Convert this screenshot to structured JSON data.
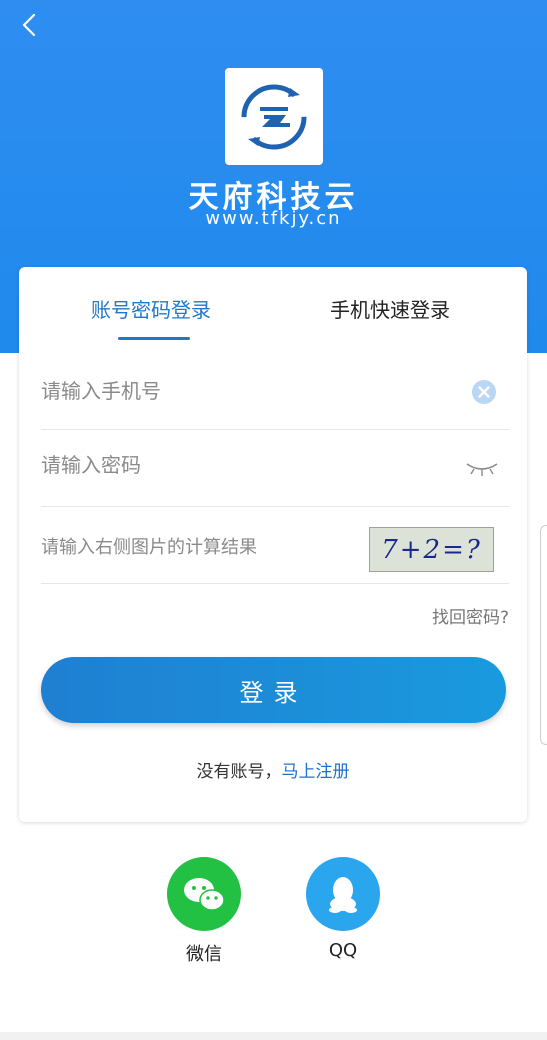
{
  "header": {
    "back_icon": "back-chevron-icon",
    "logo_icon": "tianfu-cloud-logo-icon",
    "brand_name": "天府科技云",
    "brand_url": "www.tfkjy.cn",
    "color": "#2f8df0"
  },
  "tabs": [
    {
      "label": "账号密码登录",
      "active": true
    },
    {
      "label": "手机快速登录",
      "active": false
    }
  ],
  "form": {
    "phone_placeholder": "请输入手机号",
    "password_placeholder": "请输入密码",
    "captcha_placeholder": "请输入右侧图片的计算结果",
    "captcha_text": "7+2=?",
    "forgot_label": "找回密码?",
    "login_label": "登录",
    "no_account_text": "没有账号，",
    "register_label": "马上注册",
    "accent_color": "#1f78c8"
  },
  "social": [
    {
      "label": "微信",
      "icon": "wechat-icon",
      "color": "#22c144"
    },
    {
      "label": "QQ",
      "icon": "qq-icon",
      "color": "#2aa6ef"
    }
  ]
}
